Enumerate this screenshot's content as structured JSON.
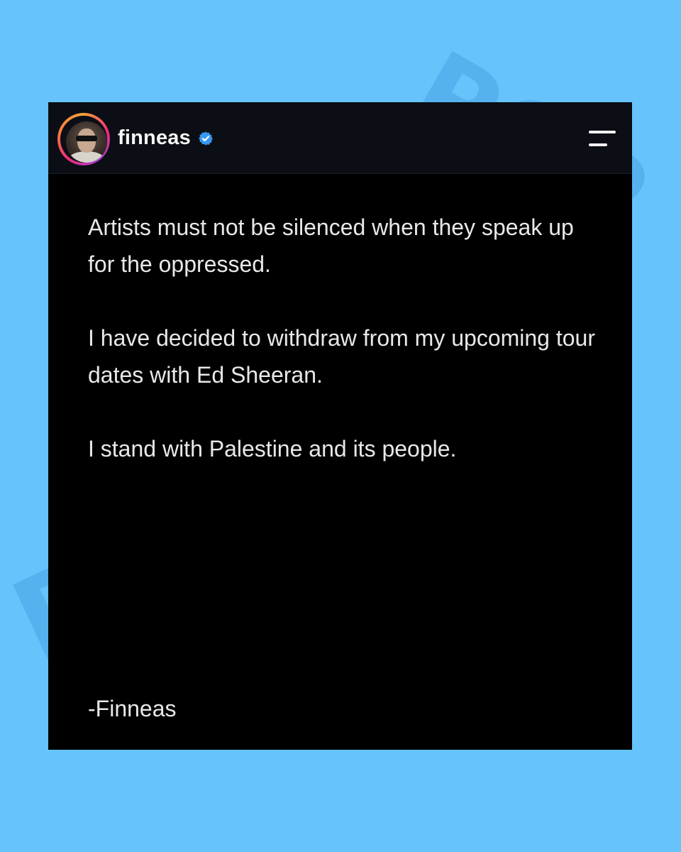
{
  "profile": {
    "username": "finneas",
    "verified": true,
    "verified_icon": "verified-badge-icon",
    "accent_color": "#3897f0"
  },
  "post": {
    "paragraphs": [
      "Artists must not be silenced when they speak up for the oppressed.",
      "I have decided to withdraw from my upcoming tour dates with Ed Sheeran.",
      "I stand with Palestine and its people."
    ],
    "signature": "-Finneas"
  },
  "header": {
    "menu_icon": "hamburger-menu-icon"
  },
  "colors": {
    "background": "#66c3fc",
    "card": "#000000",
    "header": "#0b0e14",
    "text": "#e8e8e8"
  }
}
